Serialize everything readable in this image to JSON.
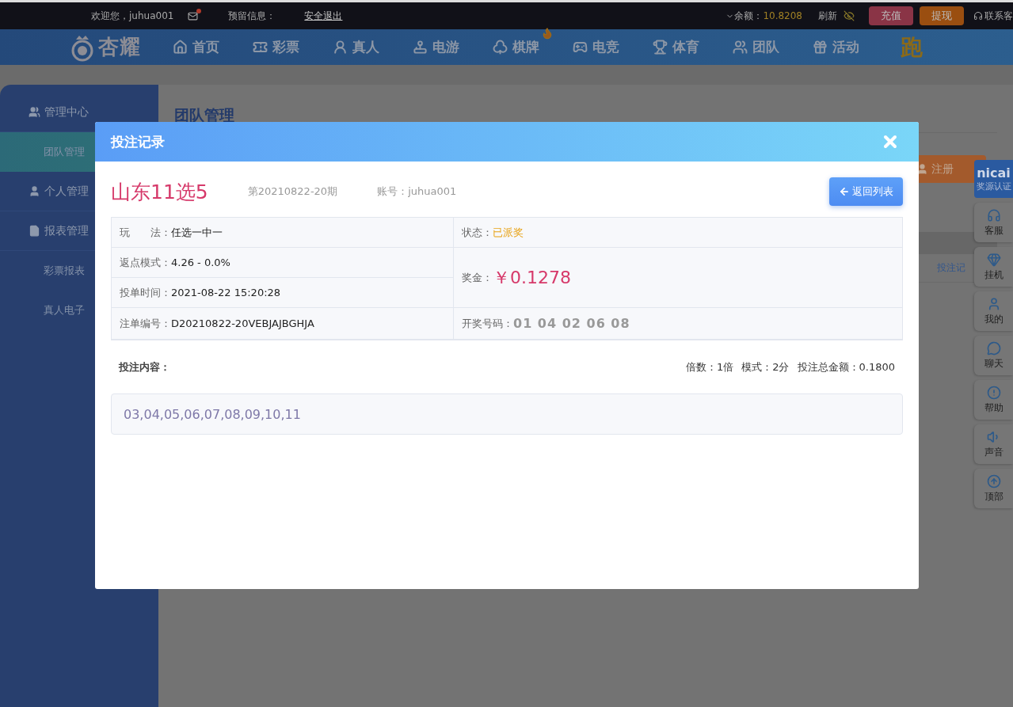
{
  "top_bar": {
    "welcome": "欢迎您，juhua001",
    "mail_unread": true,
    "reserved_info": "预留信息：",
    "logout": "安全退出",
    "balance_label": "余额：",
    "balance": "10.8208",
    "refresh": "刷新",
    "buttons": [
      {
        "label": "充值",
        "kind": "deposit"
      },
      {
        "label": "提现",
        "kind": "withdraw"
      }
    ],
    "support": "联系客"
  },
  "nav": {
    "logo": "杏耀",
    "items": [
      {
        "label": "首页",
        "selected": false,
        "hot": false
      },
      {
        "label": "彩票",
        "selected": false,
        "hot": false
      },
      {
        "label": "真人",
        "selected": false,
        "hot": false
      },
      {
        "label": "电游",
        "selected": false,
        "hot": false
      },
      {
        "label": "棋牌",
        "selected": false,
        "hot": true
      },
      {
        "label": "电竞",
        "selected": false,
        "hot": false
      },
      {
        "label": "体育",
        "selected": false,
        "hot": false
      },
      {
        "label": "团队",
        "selected": false,
        "hot": false
      },
      {
        "label": "活动",
        "selected": false,
        "hot": false
      }
    ],
    "trailing": "跑"
  },
  "sidebar": {
    "groups": [
      {
        "label": "管理中心",
        "children": [
          {
            "label": "团队管理",
            "selected": true
          }
        ]
      },
      {
        "label": "个人管理"
      },
      {
        "label": "报表管理",
        "children": [
          {
            "label": "彩票报表",
            "selected": false
          },
          {
            "label": "真人电子",
            "selected": false
          }
        ]
      }
    ]
  },
  "main": {
    "title": "团队管理",
    "register_button": "注册",
    "row_link": "投注记"
  },
  "dock": {
    "badge": {
      "brand": "nicai",
      "caption": "奖源认证"
    },
    "items": [
      "客服",
      "挂机",
      "我的",
      "聊天",
      "帮助",
      "声音",
      "顶部"
    ]
  },
  "modal": {
    "title": "投注记录",
    "game": "山东11选5",
    "issue": "第20210822-20期",
    "account": "账号：juhua001",
    "back_button": "返回列表",
    "details": [
      {
        "label": "玩　　法：",
        "value": "任选一中一",
        "kind": "plain"
      },
      {
        "label": "状态：",
        "value": "已派奖",
        "kind": "status"
      },
      {
        "label": "返点模式：",
        "value": "4.26 - 0.0%",
        "kind": "plain"
      },
      {
        "label": "奖金：",
        "value": "￥0.1278",
        "kind": "prize"
      },
      {
        "label": "投单时间：",
        "value": "2021-08-22 15:20:28",
        "kind": "plain"
      },
      {
        "label": "注单编号：",
        "value": "D20210822-20VEBJAJBGHJA",
        "kind": "plain"
      },
      {
        "label": "开奖号码：",
        "value": "01 04 02 06 08",
        "kind": "draw"
      }
    ],
    "content_label": "投注内容：",
    "summary": [
      "倍数：1倍",
      "模式：2分",
      "投注总金额：0.1800"
    ],
    "numbers": "03,04,05,06,07,08,09,10,11"
  }
}
